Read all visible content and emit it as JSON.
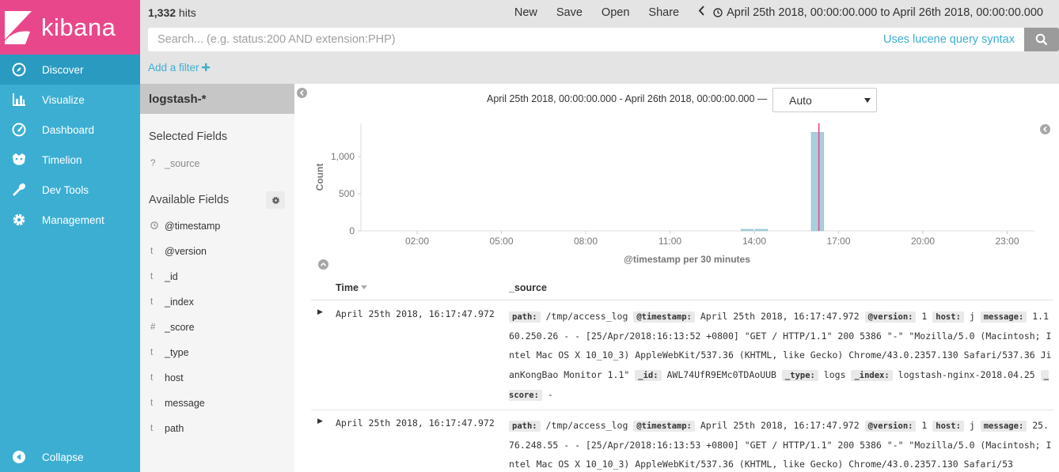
{
  "app": {
    "logo_text": "kibana"
  },
  "nav": {
    "items": [
      {
        "label": "Discover",
        "icon": "compass-icon",
        "active": true
      },
      {
        "label": "Visualize",
        "icon": "bar-chart-icon"
      },
      {
        "label": "Dashboard",
        "icon": "gauge-icon"
      },
      {
        "label": "Timelion",
        "icon": "timelion-icon"
      },
      {
        "label": "Dev Tools",
        "icon": "wrench-icon"
      },
      {
        "label": "Management",
        "icon": "gear-icon"
      }
    ],
    "collapse_label": "Collapse"
  },
  "topbar": {
    "hits_count": "1,332",
    "hits_label": " hits",
    "menu": {
      "new": "New",
      "save": "Save",
      "open": "Open",
      "share": "Share"
    },
    "time_range": "April 25th 2018, 00:00:00.000 to April 26th 2018, 00:00:00.000",
    "search_placeholder": "Search... (e.g. status:200 AND extension:PHP)",
    "lucene_link": "Uses lucene query syntax",
    "add_filter": "Add a filter"
  },
  "sidebar_fields": {
    "index_pattern": "logstash-*",
    "selected_title": "Selected Fields",
    "selected": [
      {
        "type": "?",
        "name": "_source"
      }
    ],
    "available_title": "Available Fields",
    "available": [
      {
        "type": "clock",
        "name": "@timestamp"
      },
      {
        "type": "t",
        "name": "@version"
      },
      {
        "type": "t",
        "name": "_id"
      },
      {
        "type": "t",
        "name": "_index"
      },
      {
        "type": "#",
        "name": "_score"
      },
      {
        "type": "t",
        "name": "_type"
      },
      {
        "type": "t",
        "name": "host"
      },
      {
        "type": "t",
        "name": "message"
      },
      {
        "type": "t",
        "name": "path"
      }
    ]
  },
  "histogram": {
    "range_text": "April 25th 2018, 00:00:00.000 - April 26th 2018, 00:00:00.000 —",
    "interval": "Auto"
  },
  "chart_data": {
    "type": "bar",
    "ylabel": "Count",
    "xlabel": "@timestamp per 30 minutes",
    "ylim": [
      0,
      1450
    ],
    "yticks": [
      0,
      500,
      1000
    ],
    "ytick_labels": [
      "0",
      "500",
      "1,000"
    ],
    "xlim_hours": [
      0,
      24
    ],
    "xticks_hours": [
      2,
      5,
      8,
      11,
      14,
      17,
      20,
      23
    ],
    "xtick_labels": [
      "02:00",
      "05:00",
      "08:00",
      "11:00",
      "14:00",
      "17:00",
      "20:00",
      "23:00"
    ],
    "bars": [
      {
        "start_hour": 13.5,
        "value": 2
      },
      {
        "start_hour": 14.0,
        "value": 2
      },
      {
        "start_hour": 16.0,
        "value": 1328
      }
    ],
    "bar_width_hours": 0.5,
    "now_marker_hour": 16.3,
    "bar_color": "#a9cfdc",
    "marker_color": "#e8488b",
    "grid": false
  },
  "table": {
    "headers": {
      "time": "Time",
      "source": "_source"
    },
    "rows": [
      {
        "time": "April 25th 2018, 16:17:47.972",
        "fields": [
          {
            "k": "path:",
            "v": "/tmp/access_log"
          },
          {
            "k": "@timestamp:",
            "v": "April 25th 2018, 16:17:47.972"
          },
          {
            "k": "@version:",
            "v": "1"
          },
          {
            "k": "host:",
            "v": "j"
          },
          {
            "k": "message:",
            "v": "1.160.250.26 - - [25/Apr/2018:16:13:52 +0800] \"GET / HTTP/1.1\" 200 5386 \"-\" \"Mozilla/5.0 (Macintosh; Intel Mac OS X 10_10_3) AppleWebKit/537.36 (KHTML, like Gecko) Chrome/43.0.2357.130 Safari/537.36 JianKongBao Monitor 1.1\""
          },
          {
            "k": "_id:",
            "v": "AWL74UfR9EMc0TDAoUUB"
          },
          {
            "k": "_type:",
            "v": "logs"
          },
          {
            "k": "_index:",
            "v": "logstash-nginx-2018.04.25"
          },
          {
            "k": "_score:",
            "v": "-"
          }
        ]
      },
      {
        "time": "April 25th 2018, 16:17:47.972",
        "fields": [
          {
            "k": "path:",
            "v": "/tmp/access_log"
          },
          {
            "k": "@timestamp:",
            "v": "April 25th 2018, 16:17:47.972"
          },
          {
            "k": "@version:",
            "v": "1"
          },
          {
            "k": "host:",
            "v": "j"
          },
          {
            "k": "message:",
            "v": "25.76.248.55 - - [25/Apr/2018:16:13:53 +0800] \"GET / HTTP/1.1\" 200 5386 \"-\" \"Mozilla/5.0 (Macintosh; Intel Mac OS X 10_10_3) AppleWebKit/537.36 (KHTML, like Gecko) Chrome/43.0.2357.130 Safari/53"
          }
        ]
      }
    ]
  }
}
